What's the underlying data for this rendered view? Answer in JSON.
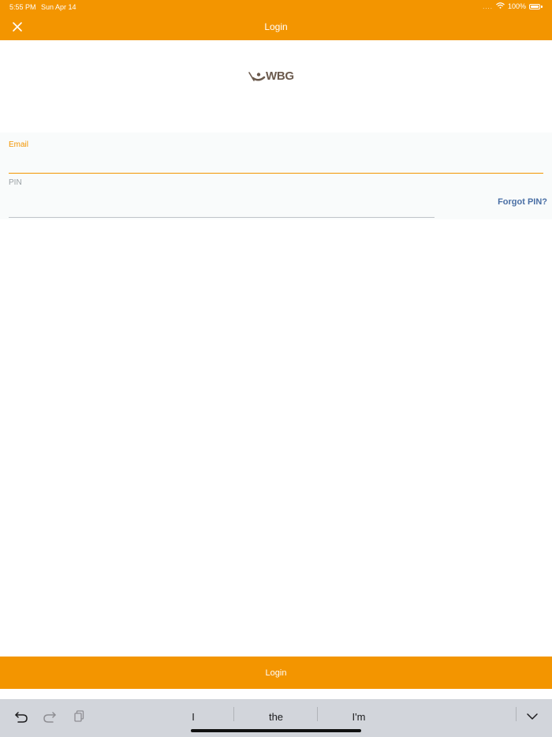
{
  "status_bar": {
    "time": "5:55 PM",
    "date": "Sun Apr 14",
    "signal_dots": "....",
    "wifi_icon": "wifi-icon",
    "battery": "100%"
  },
  "nav": {
    "title": "Login",
    "close_icon": "close-icon"
  },
  "logo": {
    "text": "WBG"
  },
  "form": {
    "email_label": "Email",
    "email_value": "",
    "pin_label": "PIN",
    "pin_value": "",
    "forgot_link": "Forgot PIN?"
  },
  "login_button": {
    "label": "Login"
  },
  "keyboard_bar": {
    "undo_icon": "undo-icon",
    "redo_icon": "redo-icon",
    "paste_icon": "paste-icon",
    "suggestions": [
      "I",
      "the",
      "I'm"
    ],
    "dismiss_icon": "chevron-down-icon"
  },
  "colors": {
    "accent": "#f39500",
    "link": "#4a6fa5",
    "logo": "#6b5a4d"
  }
}
